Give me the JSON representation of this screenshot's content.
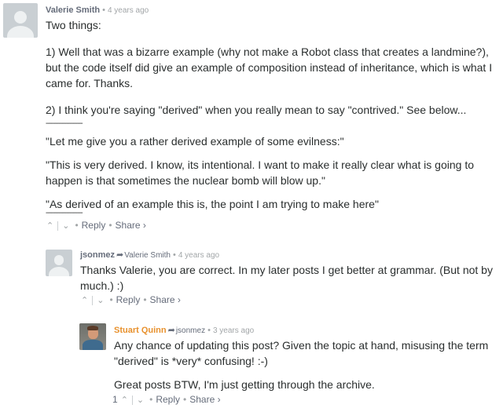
{
  "comments": [
    {
      "author": "Valerie Smith",
      "timestamp": "4 years ago",
      "paragraphs": [
        "Two things:",
        "1) Well that was a bizarre example (why not make a Robot class that creates a landmine?), but the code itself did give an example of composition instead of inheritance, which is what I came for. Thanks.",
        "2) I think you're saying \"derived\" when you really mean to say \"contrived.\" See below...",
        "--------------------",
        "\"Let me give you a rather derived example of some evilness:\"",
        "\"This is very derived. I know, its intentional. I want to make it really clear what is going to happen is that sometimes the nuclear bomb will blow up.\"",
        "\"As derived of an example this is, the point I am trying to make here\"",
        "--------------------"
      ],
      "reply_label": "Reply",
      "share_label": "Share ›"
    },
    {
      "author": "jsonmez",
      "in_reply_to": "Valerie Smith",
      "timestamp": "4 years ago",
      "paragraphs": [
        "Thanks Valerie, you are correct. In my later posts I get better at grammar. (But not by much.) :)"
      ],
      "reply_label": "Reply",
      "share_label": "Share ›"
    },
    {
      "author": "Stuart Quinn",
      "in_reply_to": "jsonmez",
      "timestamp": "3 years ago",
      "paragraphs": [
        "Any chance of updating this post? Given the topic at hand, misusing the term \"derived\" is *very* confusing! :-)",
        "Great posts BTW, I'm just getting through the archive."
      ],
      "upvotes": "1",
      "reply_label": "Reply",
      "share_label": "Share ›"
    }
  ],
  "icons": {
    "upvote": "chevron-up-icon",
    "downvote": "chevron-down-icon",
    "reply_arrow": "reply-arrow-icon"
  },
  "colors": {
    "author_default": "#656c7a",
    "author_highlight": "#e8912d",
    "meta": "#a2a6a8",
    "text": "#2a2e2e"
  }
}
